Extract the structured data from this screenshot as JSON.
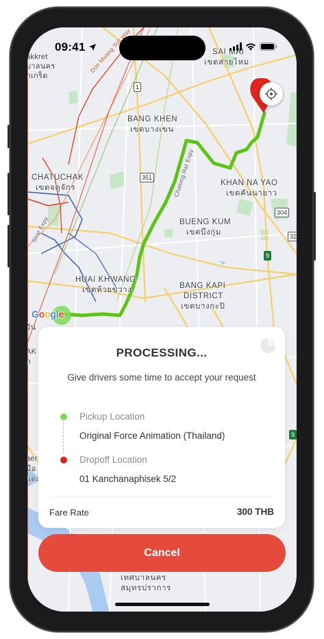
{
  "status_bar": {
    "time": "09:41"
  },
  "map": {
    "labels": {
      "sai_mai": "SAI MAI",
      "sai_mai_thai": "เขตสายไหม",
      "bang_khen": "BANG KHEN",
      "bang_khen_thai": "เขตบางเขน",
      "chatuchak": "CHATUCHAK",
      "chatuchak_thai": "เขตจตุจักร",
      "khan_na_yao": "KHAN NA YAO",
      "khan_na_yao_thai": "เขตคันนายาว",
      "bueng_kum": "BUENG KUM",
      "bueng_kum_thai": "เขตบึงกุ่ม",
      "huai_khwang": "HUAI KHWANG",
      "huai_khwang_thai": "เขตห้วยขวาง",
      "bang_kapi": "BANG KAPI",
      "bang_kapi_district": "DISTRICT",
      "bang_kapi_thai": "เขตบางกะปิ",
      "samut_1": "เทศบาลนคร",
      "samut_2": "สมุทรปราการ",
      "edge_top_1": "akkret",
      "edge_top_2": "บาลนคร",
      "edge_top_3": "กเกร็ด",
      "edge_mid_1": "วัน",
      "edge_mid_2": "AK",
      "edge_mid_3": "ก",
      "edge_low_1": "aer",
      "edge_low_2": "มือ",
      "edge_low_3": "แดง",
      "road_don_muang": "Don Muang Toll Way",
      "road_chalong_rat": "Chalong Rat Expy",
      "road_sirat": "Sirat Expy"
    },
    "road_shields": {
      "r1": "1",
      "r351": "351",
      "r304": "304",
      "r32": "32",
      "r9a": "9",
      "r9b": "9"
    },
    "google_logo": "Google"
  },
  "card": {
    "title": "PROCESSING...",
    "subtitle": "Give drivers some time to accept your request",
    "pickup_label": "Pickup Location",
    "pickup_value": "Original Force Animation (Thailand)",
    "dropoff_label": "Dropoff Location",
    "dropoff_value": "01 Kanchanaphisek 5/2",
    "fare_label": "Fare Rate",
    "fare_value": "300 THB"
  },
  "cancel_button": {
    "label": "Cancel"
  },
  "colors": {
    "route": "#5cc414",
    "pickup": "#7ed957",
    "dropoff": "#d9271c",
    "cancel": "#e54b3c"
  }
}
